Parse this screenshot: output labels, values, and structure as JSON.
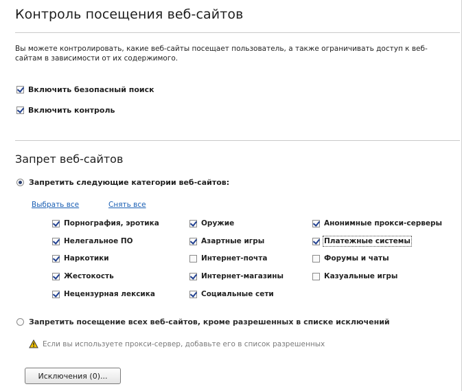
{
  "header": {
    "title": "Контроль посещения веб-сайтов"
  },
  "description": "Вы можете контролировать, какие веб-сайты посещает пользователь, а также ограничивать доступ к веб-сайтам в зависимости от их содержимого.",
  "options": {
    "safe_search": {
      "label": "Включить безопасный поиск",
      "checked": true
    },
    "enable_control": {
      "label": "Включить контроль",
      "checked": true
    }
  },
  "block_section": {
    "title": "Запрет веб-сайтов",
    "categories_radio": {
      "label": "Запретить следующие категории веб-сайтов:",
      "selected": true
    },
    "select_all": "Выбрать все",
    "clear_all": "Снять все",
    "categories": [
      {
        "label": "Порнография, эротика",
        "checked": true
      },
      {
        "label": "Нелегальное ПО",
        "checked": true
      },
      {
        "label": "Наркотики",
        "checked": true
      },
      {
        "label": "Жестокость",
        "checked": true
      },
      {
        "label": "Нецензурная лексика",
        "checked": true
      },
      {
        "label": "Оружие",
        "checked": true
      },
      {
        "label": "Азартные игры",
        "checked": true
      },
      {
        "label": "Интернет-почта",
        "checked": false
      },
      {
        "label": "Интернет-магазины",
        "checked": true
      },
      {
        "label": "Социальные сети",
        "checked": true
      },
      {
        "label": "Анонимные прокси-серверы",
        "checked": true
      },
      {
        "label": "Платежные системы",
        "checked": true
      },
      {
        "label": "Форумы и чаты",
        "checked": false
      },
      {
        "label": "Казуальные игры",
        "checked": false
      }
    ],
    "allowlist_radio": {
      "label": "Запретить посещение всех веб-сайтов, кроме разрешенных в списке исключений",
      "selected": false
    },
    "warning": "Если вы используете прокси-сервер, добавьте его в список разрешенных",
    "exceptions_button": "Исключения (0)..."
  },
  "colors": {
    "link": "#1a5fb4",
    "rule": "#c9c9c9",
    "muted_text": "#7a7a7a"
  },
  "icons": {
    "warning": "warning-triangle-icon"
  }
}
